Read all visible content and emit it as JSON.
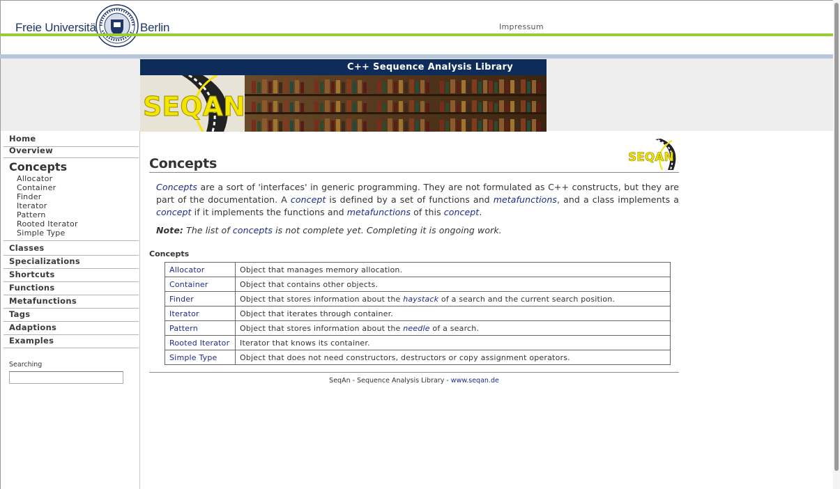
{
  "header": {
    "university_left": "Freie Universität",
    "university_right": "Berlin",
    "impressum": "Impressum"
  },
  "banner": {
    "title": "C++ Sequence Analysis Library",
    "logo_text": "SEQAN"
  },
  "sidebar": {
    "top_items": [
      {
        "label": "Home"
      },
      {
        "label": "Overview"
      }
    ],
    "heading": "Concepts",
    "sub_items": [
      {
        "label": "Allocator"
      },
      {
        "label": "Container"
      },
      {
        "label": "Finder"
      },
      {
        "label": "Iterator"
      },
      {
        "label": "Pattern"
      },
      {
        "label": "Rooted Iterator"
      },
      {
        "label": "Simple Type"
      }
    ],
    "items": [
      {
        "label": "Classes"
      },
      {
        "label": "Specializations"
      },
      {
        "label": "Shortcuts"
      },
      {
        "label": "Functions"
      },
      {
        "label": "Metafunctions"
      },
      {
        "label": "Tags"
      },
      {
        "label": "Adaptions"
      },
      {
        "label": "Examples"
      }
    ],
    "search_label": "Searching",
    "search_value": ""
  },
  "main": {
    "title": "Concepts",
    "intro": {
      "p1_link_concepts": "Concepts",
      "p1_t1": " are a sort of 'interfaces' in generic programming. They are not formulated as C++ constructs, but they are part of the documentation. A ",
      "p1_link_concept1": "concept",
      "p1_t2": " is defined by a set of functions and ",
      "p1_link_metafunctions1": "metafunctions",
      "p1_t3": ", and a class implements a ",
      "p1_link_concept2": "concept",
      "p1_t4": " if it implements the functions and ",
      "p1_link_metafunctions2": "metafunctions",
      "p1_t5": " of this ",
      "p1_link_concept3": "concept",
      "p1_t6": "."
    },
    "note": {
      "label": "Note:",
      "t1": " The list of ",
      "link": "concepts",
      "t2": " is not complete yet. Completing it is ongoing work."
    },
    "section_label": "Concepts",
    "table": [
      {
        "name": "Allocator",
        "desc": "Object that manages memory allocation."
      },
      {
        "name": "Container",
        "desc": "Object that contains other objects."
      },
      {
        "name": "Finder",
        "desc_pre": "Object that stores information about the ",
        "desc_link": "haystack",
        "desc_post": " of a search and the current search position."
      },
      {
        "name": "Iterator",
        "desc": "Object that iterates through container."
      },
      {
        "name": "Pattern",
        "desc_pre": "Object that stores information about the ",
        "desc_link": "needle",
        "desc_post": " of a search."
      },
      {
        "name": "Rooted Iterator",
        "desc": "Iterator that knows its container."
      },
      {
        "name": "Simple Type",
        "desc": "Object that does not need constructors, destructors or copy assignment operators."
      }
    ],
    "footer_text": "SeqAn - Sequence Analysis Library - ",
    "footer_link": "www.seqan.de"
  },
  "colors": {
    "green_line": "#99cc33",
    "navy": "#0e2c5a",
    "link": "#1b2a8a"
  }
}
